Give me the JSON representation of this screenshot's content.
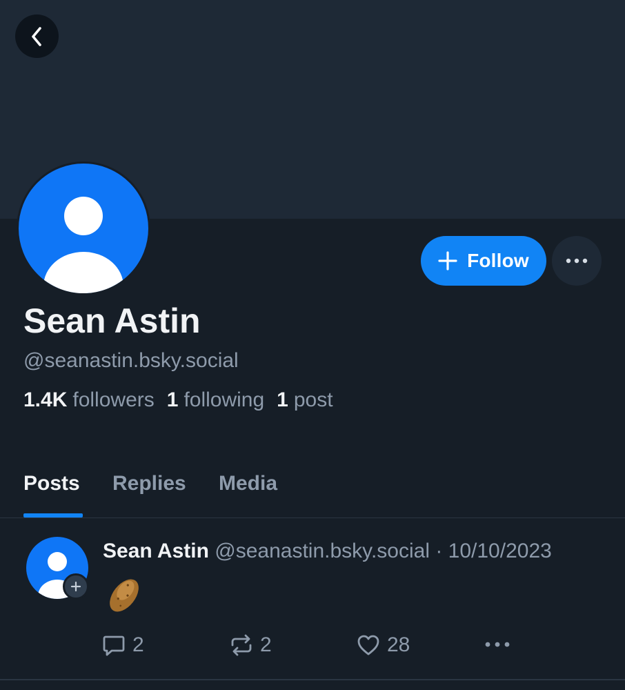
{
  "profile": {
    "display_name": "Sean Astin",
    "handle": "@seanastin.bsky.social",
    "follow_label": "Follow",
    "stats": {
      "followers_count": "1.4K",
      "followers_label": "followers",
      "following_count": "1",
      "following_label": "following",
      "posts_count": "1",
      "posts_label": "post"
    }
  },
  "tabs": [
    {
      "label": "Posts",
      "active": true
    },
    {
      "label": "Replies",
      "active": false
    },
    {
      "label": "Media",
      "active": false
    }
  ],
  "post": {
    "author_name": "Sean Astin",
    "author_handle": "@seanastin.bsky.social",
    "separator": " · ",
    "date": "10/10/2023",
    "body_icon": "potato-emoji",
    "reply_count": "2",
    "repost_count": "2",
    "like_count": "28"
  },
  "colors": {
    "accent": "#1184f5",
    "background": "#161e27",
    "banner": "#1e2936",
    "avatar": "#0f76f6",
    "muted_text": "#8e9bab"
  },
  "icons": [
    "chevron-left-icon",
    "plus-icon",
    "ellipsis-icon",
    "default-avatar-icon",
    "reply-icon",
    "repost-icon",
    "heart-icon",
    "potato-icon"
  ]
}
